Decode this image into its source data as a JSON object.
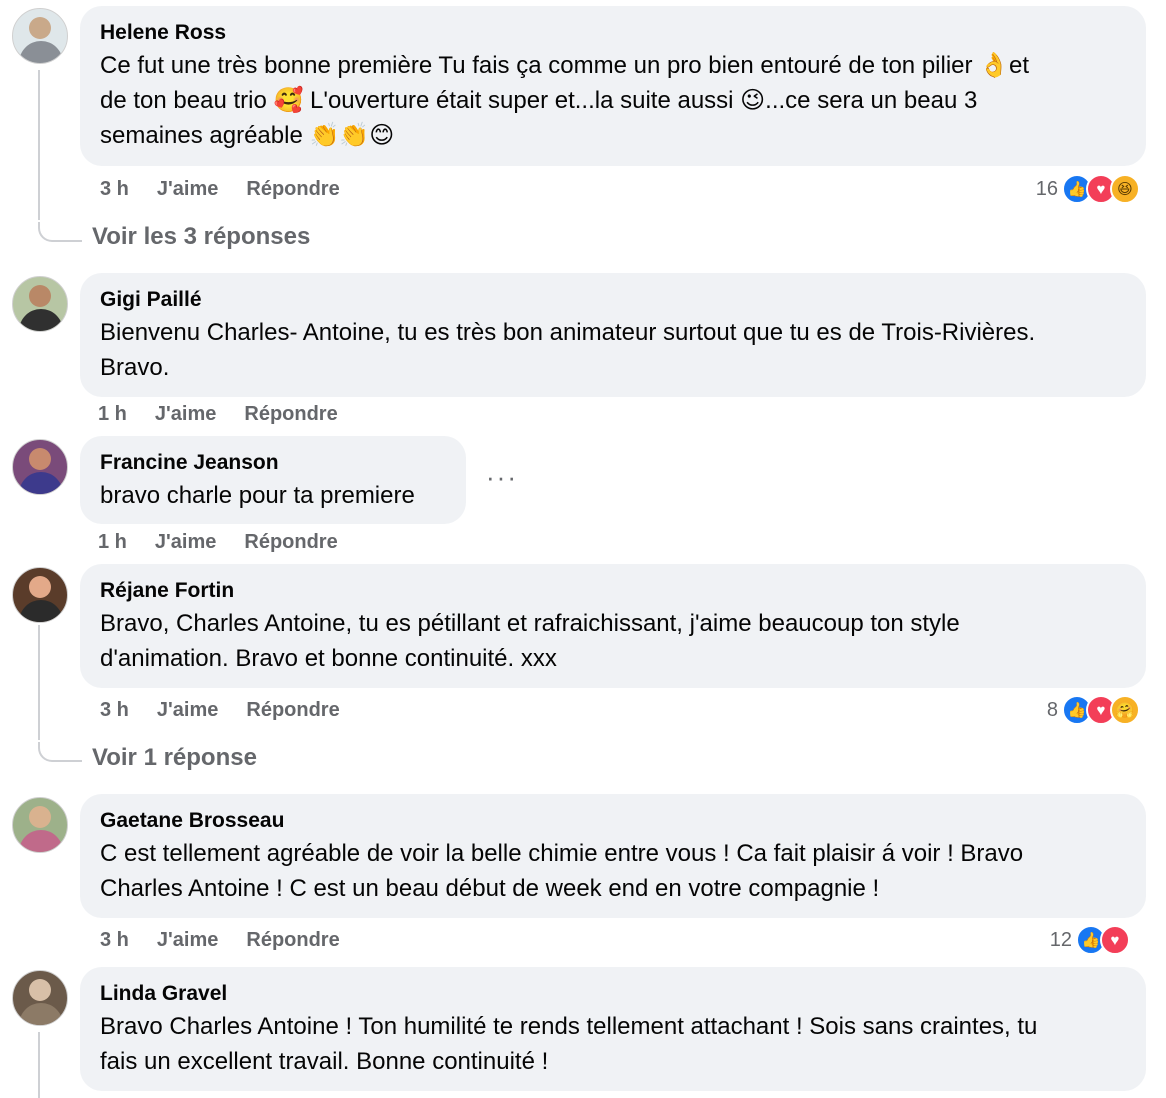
{
  "comments": [
    {
      "author": "Helene Ross",
      "lines": [
        "Ce fut une très bonne première Tu fais ça comme un pro bien entouré de ton pilier 👌et",
        "de ton beau trio 🥰 L'ouverture était super et...la suite aussi 😉...ce sera un beau 3",
        "semaines agréable 👏👏😊"
      ],
      "time": "3 h",
      "like": "J'aime",
      "reply": "Répondre",
      "reaction_count": "16",
      "view_replies": "Voir les 3 réponses"
    },
    {
      "author": "Gigi Paillé",
      "lines": [
        "Bienvenu Charles- Antoine, tu es très bon animateur surtout que tu es de Trois-Rivières.",
        "Bravo."
      ],
      "time": "1 h",
      "like": "J'aime",
      "reply": "Répondre"
    },
    {
      "author": "Francine Jeanson",
      "lines": [
        "bravo charle pour ta premiere"
      ],
      "time": "1 h",
      "like": "J'aime",
      "reply": "Répondre",
      "more": "···"
    },
    {
      "author": "Réjane Fortin",
      "lines": [
        "Bravo, Charles Antoine, tu es pétillant et rafraichissant, j'aime beaucoup ton style",
        "d'animation. Bravo et bonne continuité. xxx"
      ],
      "time": "3 h",
      "like": "J'aime",
      "reply": "Répondre",
      "reaction_count": "8",
      "view_replies": "Voir 1 réponse"
    },
    {
      "author": "Gaetane Brosseau",
      "lines": [
        "C est tellement agréable de voir la belle chimie entre vous ! Ca fait plaisir á voir ! Bravo",
        "Charles Antoine ! C est un beau début de week end en votre compagnie !"
      ],
      "time": "3 h",
      "like": "J'aime",
      "reply": "Répondre",
      "reaction_count": "12"
    },
    {
      "author": "Linda Gravel",
      "lines": [
        "Bravo Charles Antoine ! Ton humilité te rends tellement attachant ! Sois sans craintes, tu",
        "fais un excellent travail. Bonne continuité !"
      ]
    }
  ],
  "colors": {
    "bubble": "#f0f2f5",
    "meta": "#65676b",
    "like": "#1877f2",
    "love": "#f33e58"
  }
}
